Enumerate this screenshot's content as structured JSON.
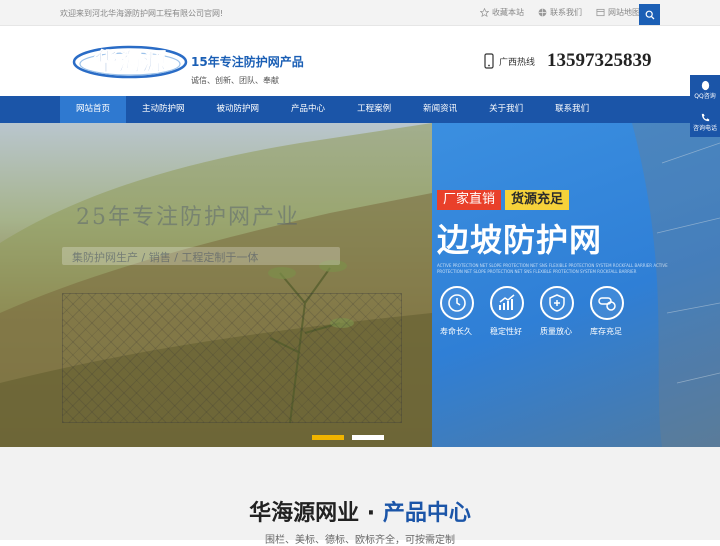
{
  "topbar": {
    "welcome": "欢迎来到河北华海源防护网工程有限公司官网!",
    "links": [
      {
        "label": "收藏本站",
        "icon": "star-icon"
      },
      {
        "label": "联系我们",
        "icon": "globe-icon"
      },
      {
        "label": "网站地图",
        "icon": "map-icon"
      }
    ],
    "search_icon": "search-icon"
  },
  "header": {
    "logo_text": "华海源",
    "slogan_title": "15年专注防护网产品",
    "slogan_sub": "诚信、创新、团队、奉献",
    "hotline_label": "广西热线",
    "hotline_number": "13597325839"
  },
  "nav": {
    "items": [
      "网站首页",
      "主动防护网",
      "被动防护网",
      "产品中心",
      "工程案例",
      "新闻资讯",
      "关于我们",
      "联系我们"
    ],
    "active_index": 0
  },
  "banner": {
    "ghost_title": "25年专注防护网产业",
    "ghost_sub": "集防护网生产 / 销售 / 工程定制于一体",
    "tag1": "厂家直销",
    "tag2": "货源充足",
    "title": "边坡防护网",
    "fine_print": "ACTIVE PROTECTION NET SLOPE PROTECTION NET SNS FLEXIBLE PROTECTION SYSTEM ROCKFALL BARRIER ACTIVE PROTECTION NET SLOPE PROTECTION NET SNS FLEXIBLE PROTECTION SYSTEM ROCKFALL BARRIER",
    "features": [
      {
        "label": "寿命长久",
        "icon": "clock-icon"
      },
      {
        "label": "稳定性好",
        "icon": "chart-up-icon"
      },
      {
        "label": "质量放心",
        "icon": "shield-plus-icon"
      },
      {
        "label": "库存充足",
        "icon": "pills-icon"
      }
    ],
    "slide_count": 2,
    "active_slide": 0
  },
  "side": {
    "items": [
      {
        "label": "QQ咨询",
        "icon": "qq-icon"
      },
      {
        "label": "咨询电话",
        "icon": "phone-icon"
      }
    ]
  },
  "section": {
    "title_main": "华海源网业 · ",
    "title_highlight": "产品中心",
    "subtitle": "围栏、美标、德标、欧标齐全，可按需定制"
  },
  "colors": {
    "brand_blue": "#1b55a8",
    "active_blue": "#2f79d0",
    "tag_red": "#e9402a",
    "tag_yellow": "#f6d23a",
    "dot_active": "#f0b400"
  }
}
